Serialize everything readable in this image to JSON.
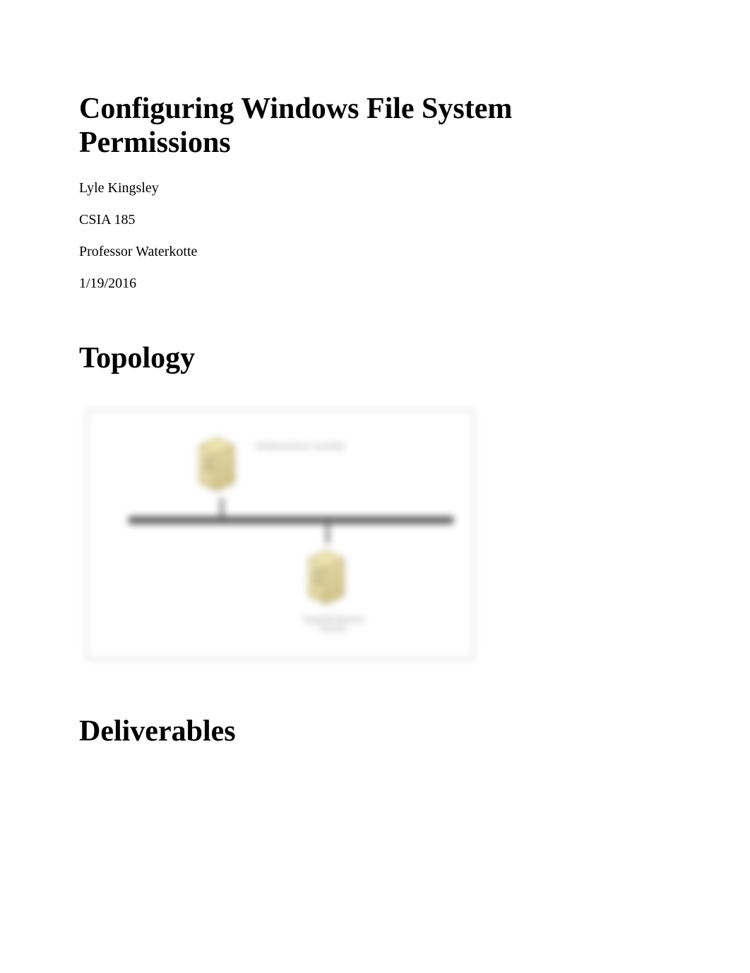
{
  "title": "Configuring Windows File System Permissions",
  "meta": {
    "author": "Lyle Kingsley",
    "course": "CSIA 185",
    "professor": "Professor Waterkotte",
    "date": "1/19/2016"
  },
  "sections": {
    "topology": "Topology",
    "deliverables": "Deliverables"
  },
  "diagram": {
    "server_top_label": "WindowsServer\nController",
    "server_bottom_label": "TargetWindows01\nDomain"
  }
}
